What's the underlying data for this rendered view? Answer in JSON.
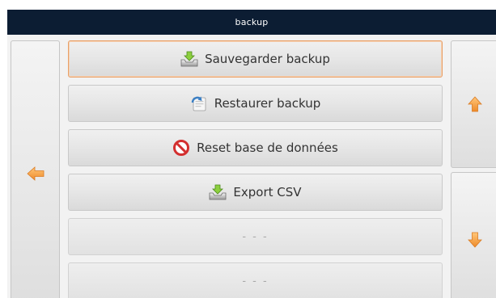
{
  "window": {
    "title": "backup"
  },
  "colors": {
    "titlebar": "#0c1d33",
    "arrow": "#f39c3c",
    "focus_border": "#e8a068",
    "no_symbol": "#d32f2f"
  },
  "navigation": {
    "back_icon": "arrow-left-icon",
    "scroll_up_icon": "arrow-up-icon",
    "scroll_down_icon": "arrow-down-icon"
  },
  "menu": {
    "items": [
      {
        "label": "Sauvegarder backup",
        "icon": "download-tray-icon"
      },
      {
        "label": "Restaurer backup",
        "icon": "restore-icon"
      },
      {
        "label": "Reset base de données",
        "icon": "no-entry-icon"
      },
      {
        "label": "Export CSV",
        "icon": "download-tray-icon"
      },
      {
        "label": "- - -"
      },
      {
        "label": "- - -"
      }
    ]
  }
}
